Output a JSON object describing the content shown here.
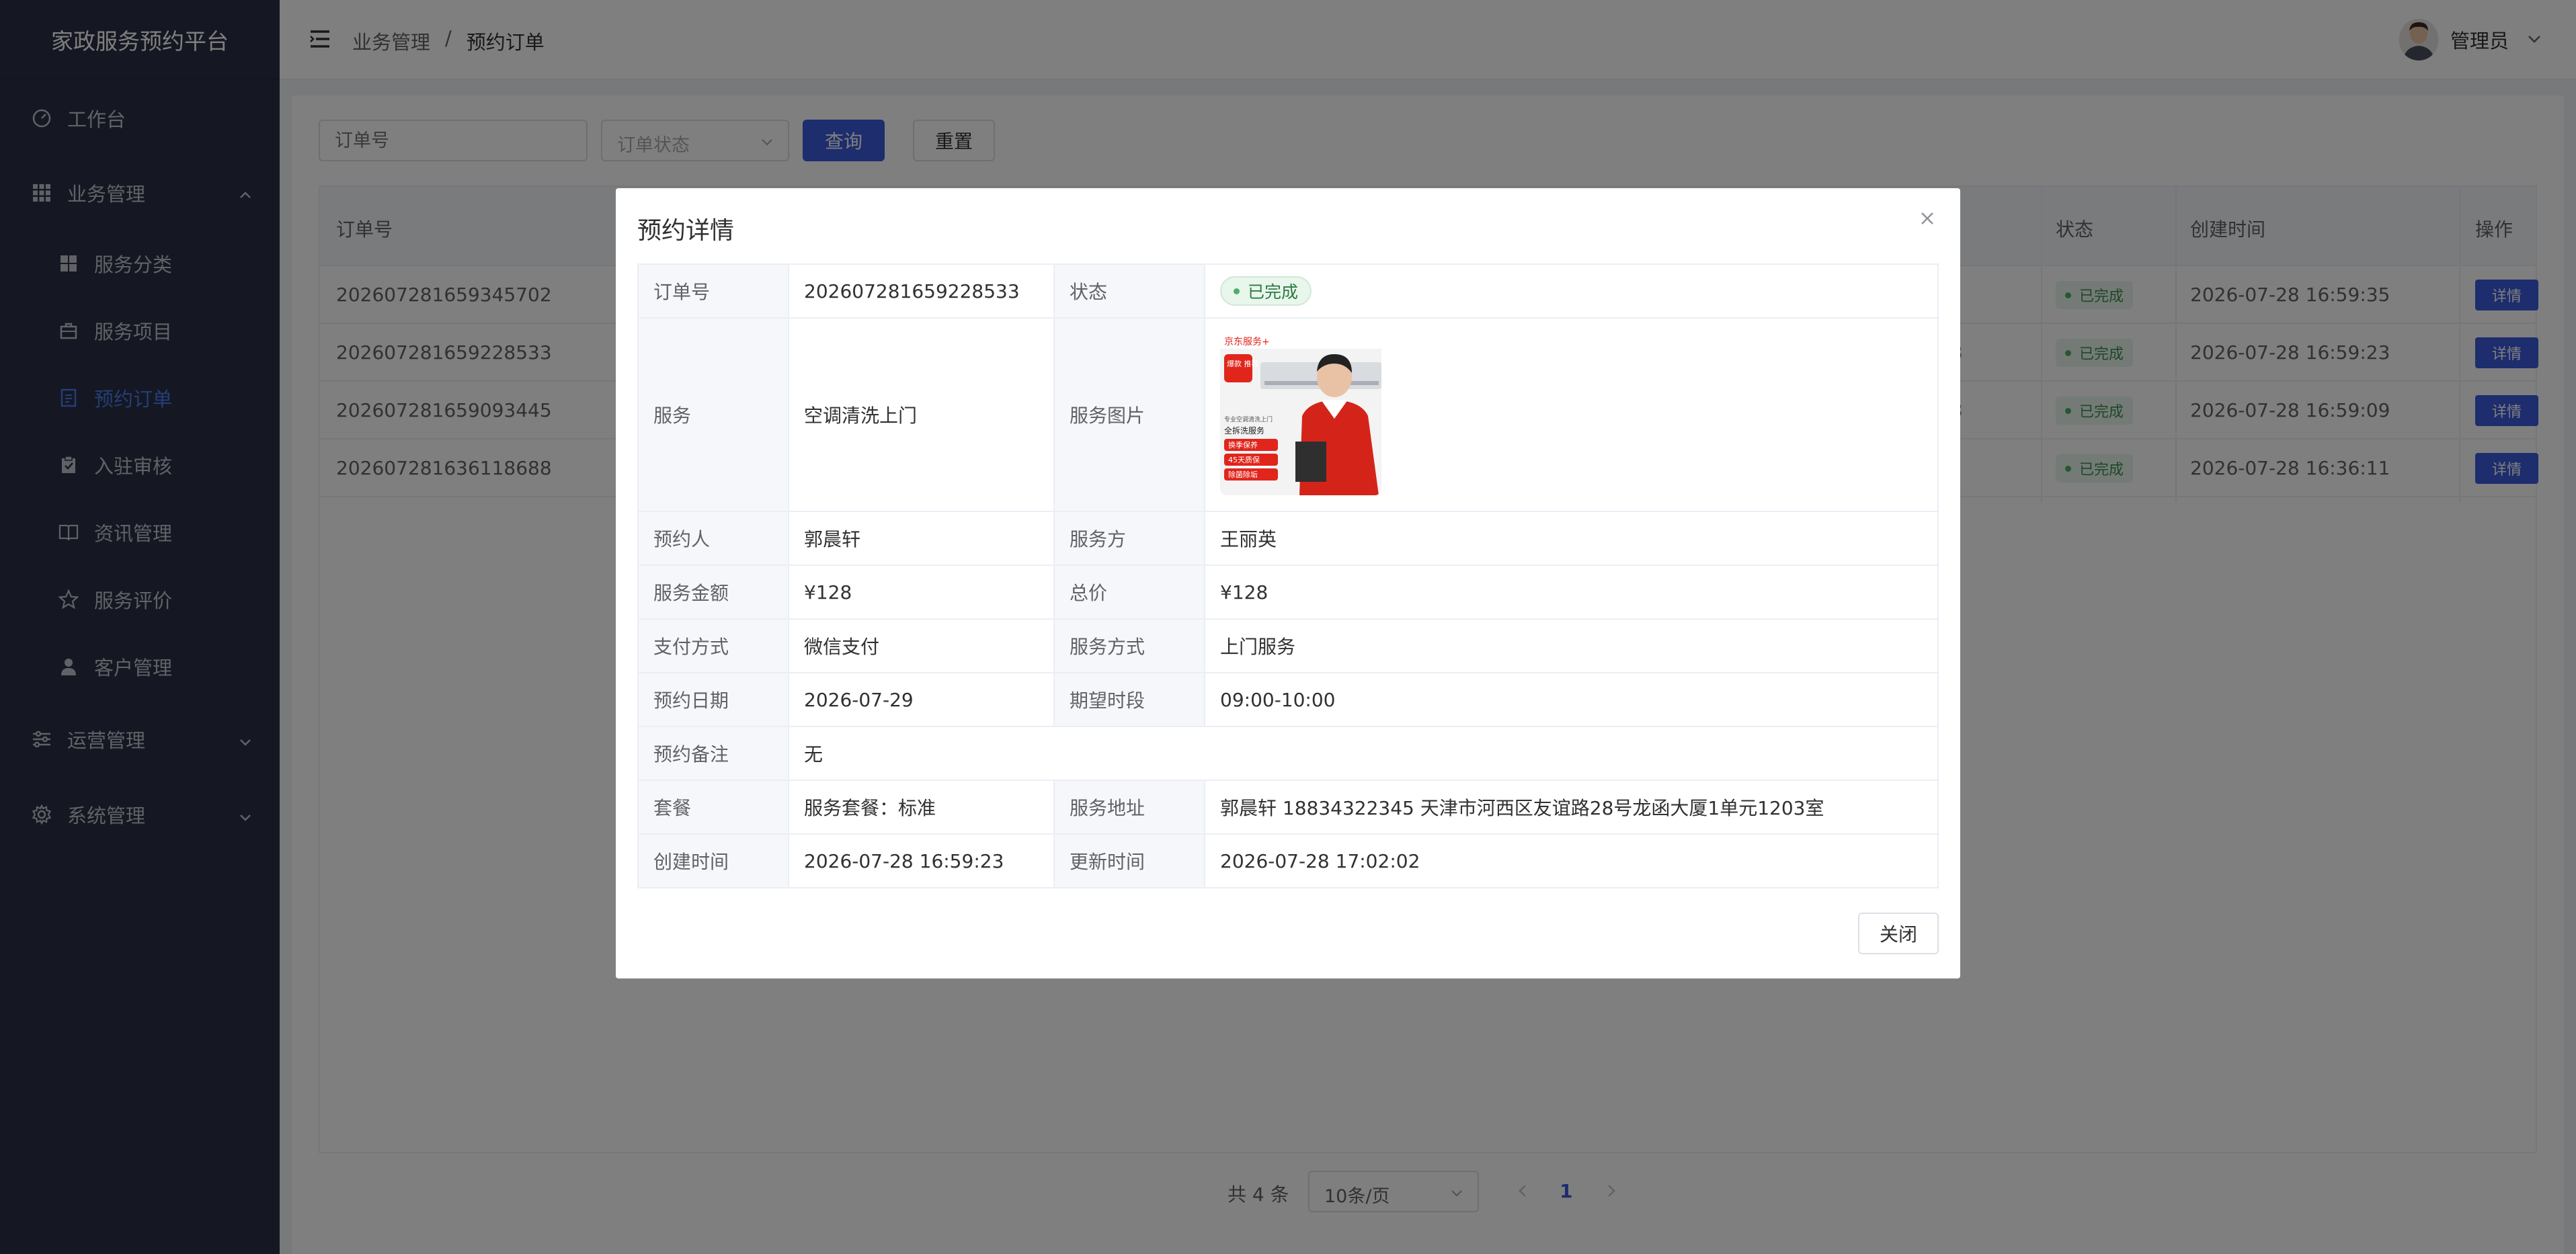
{
  "app": {
    "title": "家政服务预约平台"
  },
  "sidebar": {
    "items": [
      {
        "label": "工作台",
        "icon": "dashboard-icon"
      },
      {
        "label": "业务管理",
        "icon": "grid-icon",
        "expanded": true
      },
      {
        "label": "服务分类",
        "icon": "category-icon"
      },
      {
        "label": "服务项目",
        "icon": "briefcase-icon"
      },
      {
        "label": "预约订单",
        "icon": "document-icon",
        "active": true
      },
      {
        "label": "入驻审核",
        "icon": "clipboard-check-icon"
      },
      {
        "label": "资讯管理",
        "icon": "book-icon"
      },
      {
        "label": "服务评价",
        "icon": "star-icon"
      },
      {
        "label": "客户管理",
        "icon": "user-icon"
      },
      {
        "label": "运营管理",
        "icon": "sliders-icon",
        "expanded": false
      },
      {
        "label": "系统管理",
        "icon": "gear-icon",
        "expanded": false
      }
    ]
  },
  "header": {
    "breadcrumb": [
      "业务管理",
      "预约订单"
    ],
    "separator": "/",
    "user": "管理员"
  },
  "filters": {
    "order_no_placeholder": "订单号",
    "status_placeholder": "订单状态",
    "query_label": "查询",
    "reset_label": "重置"
  },
  "table": {
    "columns": {
      "order_no": "订单号",
      "status": "状态",
      "created": "创建时间",
      "action": "操作"
    },
    "rows": [
      {
        "order_no": "202607281659345702",
        "status": "已完成",
        "created": "2026-07-28 16:59:35",
        "action": "详情",
        "cut": ""
      },
      {
        "order_no": "202607281659228533",
        "status": "已完成",
        "created": "2026-07-28 16:59:23",
        "action": "详情",
        "cut": "3"
      },
      {
        "order_no": "202607281659093445",
        "status": "已完成",
        "created": "2026-07-28 16:59:09",
        "action": "详情",
        "cut": "3"
      },
      {
        "order_no": "202607281636118688",
        "status": "已完成",
        "created": "2026-07-28 16:36:11",
        "action": "详情",
        "cut": ""
      }
    ]
  },
  "pagination": {
    "total": "共 4 条",
    "page_size": "10条/页",
    "current": "1"
  },
  "dialog": {
    "title": "预约详情",
    "labels": {
      "order_no": "订单号",
      "status": "状态",
      "service": "服务",
      "image": "服务图片",
      "booker": "预约人",
      "provider": "服务方",
      "amount": "服务金额",
      "total": "总价",
      "payment": "支付方式",
      "mode": "服务方式",
      "date": "预约日期",
      "slot": "期望时段",
      "remark": "预约备注",
      "package": "套餐",
      "address": "服务地址",
      "created": "创建时间",
      "updated": "更新时间"
    },
    "values": {
      "order_no": "202607281659228533",
      "status": "已完成",
      "service": "空调清洗上门",
      "booker": "郭晨轩",
      "provider": "王丽英",
      "amount": "¥128",
      "total": "¥128",
      "payment": "微信支付",
      "mode": "上门服务",
      "date": "2026-07-29",
      "slot": "09:00-10:00",
      "remark": "无",
      "package": "服务套餐：标准",
      "address": "郭晨轩 18834322345 天津市河西区友谊路28号龙函大厦1单元1203室",
      "created": "2026-07-28 16:59:23",
      "updated": "2026-07-28 17:02:02"
    },
    "image_text": {
      "brand": "京东服务+",
      "badge": "爆款 推荐",
      "headline_small": "专业空调清洗上门",
      "headline": "全拆洗服务",
      "chip1": "换季保养",
      "chip2": "45天质保",
      "chip3": "除菌除垢"
    },
    "close_label": "关闭"
  },
  "colors": {
    "sidebar_bg": "#2a3144",
    "primary": "#3b5bdb",
    "active_menu": "#4a7bf0",
    "success": "#4caf6a"
  }
}
